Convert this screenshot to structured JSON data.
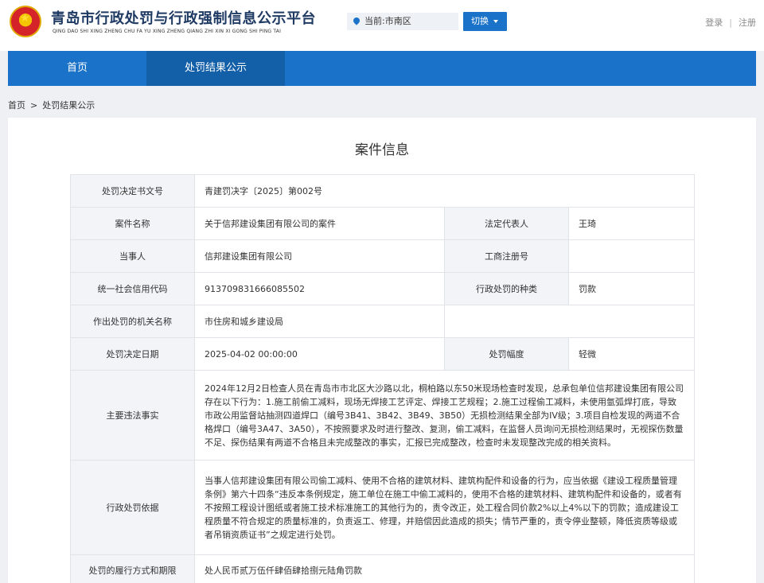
{
  "header": {
    "title": "青岛市行政处罚与行政强制信息公示平台",
    "subtitle": "QING DAO SHI XING ZHENG CHU FA YU XING ZHENG QIANG ZHI XIN XI GONG SHI PING TAI",
    "location_label": "当前:市南区",
    "switch_label": "切换",
    "login": "登录",
    "separator": "|",
    "register": "注册"
  },
  "nav": {
    "items": [
      {
        "label": "首页"
      },
      {
        "label": "处罚结果公示"
      }
    ]
  },
  "breadcrumb": {
    "home": "首页",
    "separator": ">",
    "current": "处罚结果公示"
  },
  "case": {
    "title": "案件信息",
    "rows": {
      "decision_no": {
        "label": "处罚决定书文号",
        "value": "青建罚决字〔2025〕第002号"
      },
      "case_name": {
        "label": "案件名称",
        "value": "关于信邦建设集团有限公司的案件"
      },
      "legal_rep": {
        "label": "法定代表人",
        "value": "王琦"
      },
      "party": {
        "label": "当事人",
        "value": "信邦建设集团有限公司"
      },
      "biz_reg_no": {
        "label": "工商注册号",
        "value": ""
      },
      "credit_code": {
        "label": "统一社会信用代码",
        "value": "913709831666085502"
      },
      "penalty_type": {
        "label": "行政处罚的种类",
        "value": "罚款"
      },
      "authority": {
        "label": "作出处罚的机关名称",
        "value": "市住房和城乡建设局"
      },
      "decision_date": {
        "label": "处罚决定日期",
        "value": "2025-04-02 00:00:00"
      },
      "penalty_range": {
        "label": "处罚幅度",
        "value": "轻微"
      },
      "facts": {
        "label": "主要违法事实",
        "value": "2024年12月2日检查人员在青岛市市北区大沙路以北，桐柏路以东50米现场检查时发现，总承包单位信邦建设集团有限公司存在以下行为：1.施工前偷工减料，现场无焊接工艺评定、焊接工艺规程；2.施工过程偷工减料，未使用氩弧焊打底，导致市政公用监督站抽测四道焊口（编号3B41、3B42、3B49、3B50）无损检测结果全部为IV级；3.项目自检发现的两道不合格焊口（编号3A47、3A50），不按照要求及时进行整改、复测，偷工减料，在监督人员询问无损检测结果时，无视探伤数量不足、探伤结果有两道不合格且未完成整改的事实，汇报已完成整改，检查时未发现整改完成的相关资料。"
      },
      "basis": {
        "label": "行政处罚依据",
        "value": "当事人信邦建设集团有限公司偷工减料、使用不合格的建筑材料、建筑构配件和设备的行为，应当依据《建设工程质量管理条例》第六十四条“违反本条例规定，施工单位在施工中偷工减料的，使用不合格的建筑材料、建筑构配件和设备的，或者有不按照工程设计图纸或者施工技术标准施工的其他行为的，责令改正，处工程合同价款2%以上4%以下的罚款；造成建设工程质量不符合规定的质量标准的，负责返工、修理，并赔偿因此造成的损失；情节严重的，责令停业整顿，降低资质等级或者吊销资质证书”之规定进行处罚。"
      },
      "execution": {
        "label": "处罚的履行方式和期限",
        "value": "处人民币贰万伍仟肆佰肆拾捌元陆角罚款"
      }
    }
  }
}
